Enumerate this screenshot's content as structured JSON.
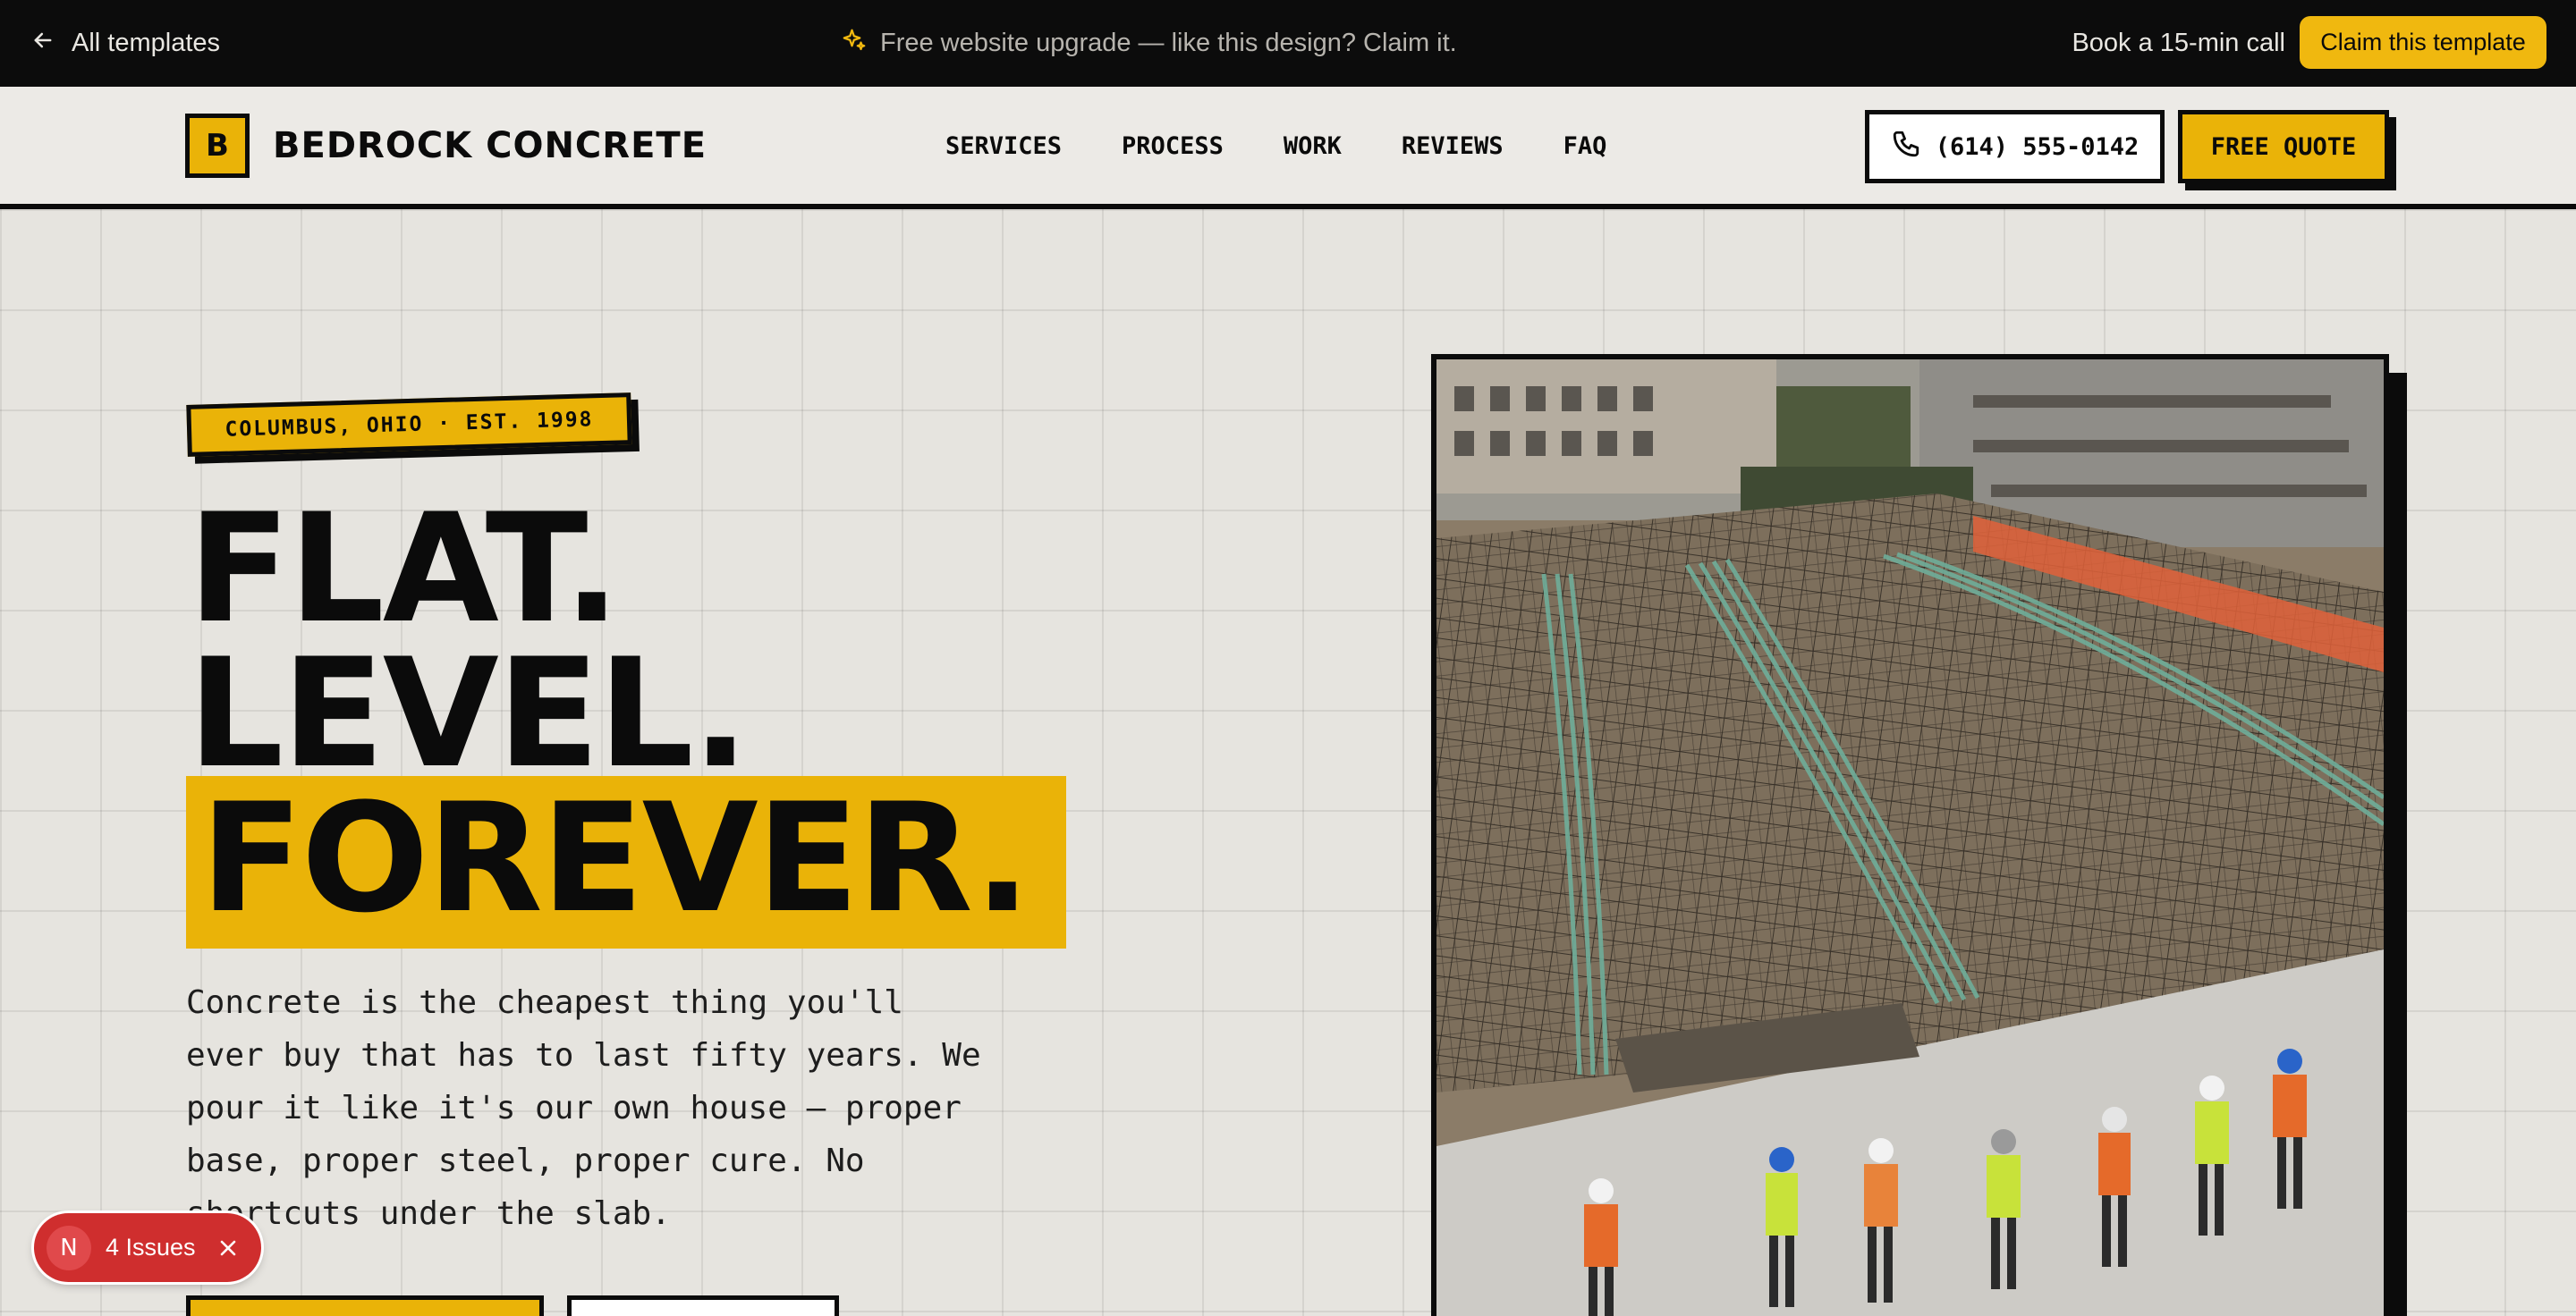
{
  "topbar": {
    "back_label": "All templates",
    "promo_text": "Free website upgrade — like this design? Claim it.",
    "book_call_label": "Book a 15-min call",
    "claim_label": "Claim this template",
    "accent_color": "#f0b80f"
  },
  "header": {
    "logo_letter": "B",
    "brand_name": "BEDROCK CONCRETE",
    "nav": [
      "SERVICES",
      "PROCESS",
      "WORK",
      "REVIEWS",
      "FAQ"
    ],
    "phone_label": "(614) 555-0142",
    "quote_label": "FREE QUOTE"
  },
  "hero": {
    "tag": "COLUMBUS, OHIO · EST. 1998",
    "headline": [
      "FLAT.",
      "LEVEL.",
      "FOREVER."
    ],
    "lede": "Concrete is the cheapest thing you'll ever buy that has to last fifty years. We pour it like it's our own house — proper base, proper steel, proper cure. No shortcuts under the slab.",
    "photo_alt": "construction-site-photo"
  },
  "issues": {
    "badge": "N",
    "label": "4 Issues"
  },
  "colors": {
    "brand_yellow": "#eab308",
    "ink": "#0b0b0b",
    "paper": "#e6e4df",
    "issue_red": "#cf2e2e"
  }
}
